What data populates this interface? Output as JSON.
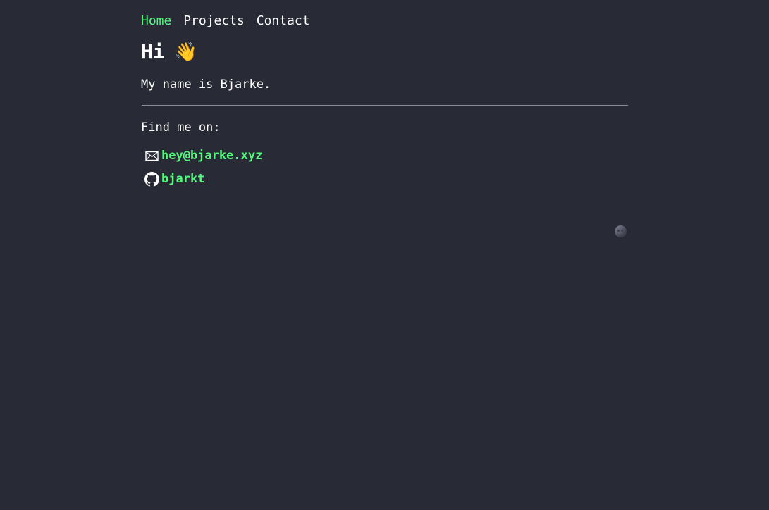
{
  "nav": {
    "items": [
      {
        "label": "Home",
        "active": true
      },
      {
        "label": "Projects",
        "active": false
      },
      {
        "label": "Contact",
        "active": false
      }
    ]
  },
  "hero": {
    "title": "Hi",
    "wave_emoji": "👋",
    "intro": "My name is Bjarke."
  },
  "contact": {
    "heading": "Find me on:",
    "links": [
      {
        "icon": "mail-icon",
        "label": "hey@bjarke.xyz"
      },
      {
        "icon": "github-icon",
        "label": "bjarkt"
      }
    ]
  },
  "theme_toggle": {
    "icon": "new-moon-icon"
  },
  "colors": {
    "background": "#282a36",
    "text": "#ffffff",
    "accent": "#50fa7b",
    "divider": "#8a8d99"
  }
}
